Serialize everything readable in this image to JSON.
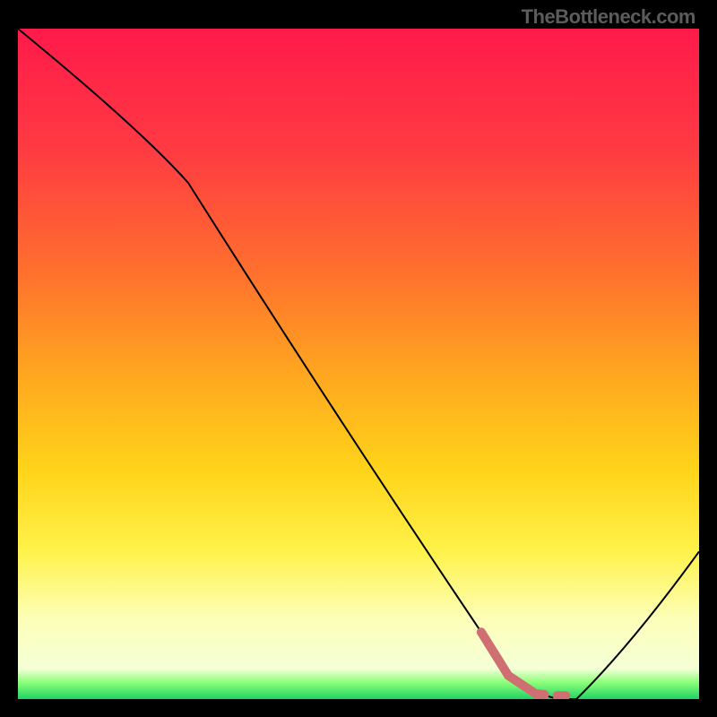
{
  "watermark": "TheBottleneck.com",
  "chart_data": {
    "type": "line",
    "title": "",
    "xlabel": "",
    "ylabel": "",
    "xlim": [
      0,
      100
    ],
    "ylim": [
      0,
      100
    ],
    "grid": false,
    "series": [
      {
        "name": "curve",
        "x": [
          0,
          25,
          72,
          80,
          82,
          100
        ],
        "y": [
          100,
          77,
          4,
          0,
          0,
          22
        ],
        "stroke": "#000000",
        "stroke_width": 2
      },
      {
        "name": "highlight-segment",
        "x": [
          68,
          72,
          76,
          79,
          80,
          81,
          82
        ],
        "y": [
          10,
          3.5,
          0.8,
          0.5,
          0.5,
          0.5,
          0.8
        ],
        "stroke": "#cf6f72",
        "stroke_width": 10,
        "dashed_tail": true
      }
    ],
    "background_gradient": {
      "stops": [
        {
          "offset": 0.0,
          "color": "#ff1a4a"
        },
        {
          "offset": 0.18,
          "color": "#ff3a42"
        },
        {
          "offset": 0.36,
          "color": "#ff6f2e"
        },
        {
          "offset": 0.52,
          "color": "#ffa81f"
        },
        {
          "offset": 0.66,
          "color": "#ffd41a"
        },
        {
          "offset": 0.78,
          "color": "#fff24a"
        },
        {
          "offset": 0.88,
          "color": "#fdffb8"
        },
        {
          "offset": 0.955,
          "color": "#f4ffd6"
        },
        {
          "offset": 0.975,
          "color": "#8cff7a"
        },
        {
          "offset": 1.0,
          "color": "#20d464"
        }
      ]
    }
  }
}
